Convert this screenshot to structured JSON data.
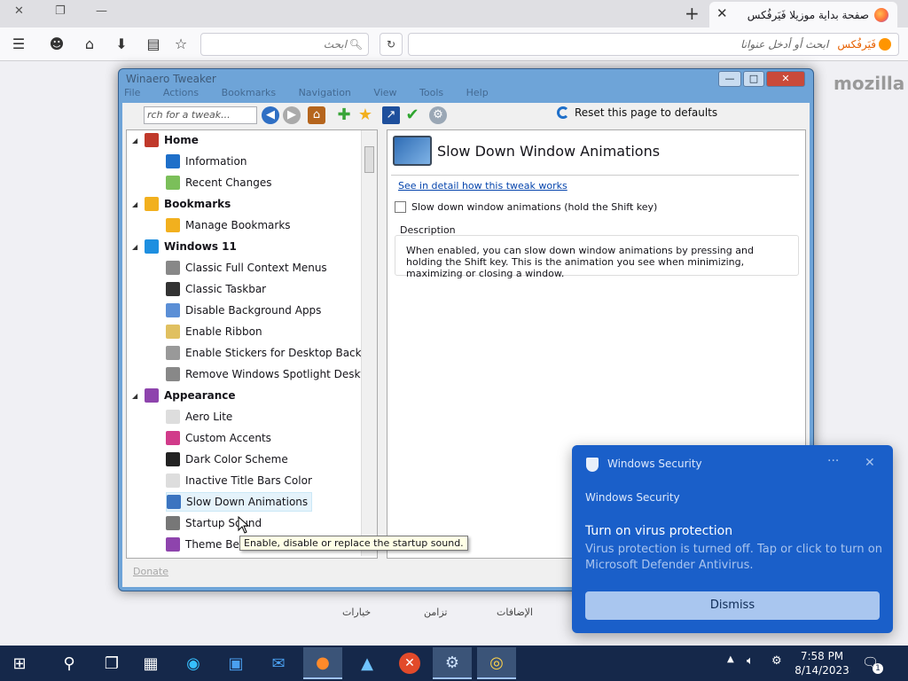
{
  "browser": {
    "tab_title": "صفحة بداية موزيلا فَيَرفُكس",
    "close_tab": "✕",
    "new_tab": "+",
    "win_controls": {
      "close": "✕",
      "restore": "❐",
      "minimize": "—"
    },
    "search_placeholder": "ابحث",
    "url_brand": "فَيَرفُكس",
    "url_placeholder": "ابحث أو أدخل عنوانا",
    "page_brand": "mozilla",
    "bottom_links": [
      "خيارات",
      "تزامن",
      "الإضافات"
    ]
  },
  "winaero": {
    "title": "Winaero Tweaker",
    "menu": [
      "File",
      "Actions",
      "Bookmarks",
      "Navigation",
      "View",
      "Tools",
      "Help"
    ],
    "search_placeholder": "rch for a tweak...",
    "reset_label": "Reset this page to defaults",
    "tree": [
      {
        "label": "Home",
        "type": "cat",
        "color": "#c0392b"
      },
      {
        "label": "Information",
        "type": "item",
        "color": "#1e6fc9"
      },
      {
        "label": "Recent Changes",
        "type": "item",
        "color": "#7bbf5a"
      },
      {
        "label": "Bookmarks",
        "type": "cat",
        "color": "#f2b01e"
      },
      {
        "label": "Manage Bookmarks",
        "type": "item",
        "color": "#f2b01e"
      },
      {
        "label": "Windows 11",
        "type": "cat",
        "color": "#1e8fe0"
      },
      {
        "label": "Classic Full Context Menus",
        "type": "item",
        "color": "#888888"
      },
      {
        "label": "Classic Taskbar",
        "type": "item",
        "color": "#333333"
      },
      {
        "label": "Disable Background Apps",
        "type": "item",
        "color": "#5b8fd6"
      },
      {
        "label": "Enable Ribbon",
        "type": "item",
        "color": "#e0c060"
      },
      {
        "label": "Enable Stickers for Desktop Background",
        "type": "item",
        "color": "#999999"
      },
      {
        "label": "Remove Windows Spotlight Desktop Icon",
        "type": "item",
        "color": "#888888"
      },
      {
        "label": "Appearance",
        "type": "cat",
        "color": "#8e44ad"
      },
      {
        "label": "Aero Lite",
        "type": "item",
        "color": "#dddddd"
      },
      {
        "label": "Custom Accents",
        "type": "item",
        "color": "#d13b8a"
      },
      {
        "label": "Dark Color Scheme",
        "type": "item",
        "color": "#222222"
      },
      {
        "label": "Inactive Title Bars Color",
        "type": "item",
        "color": "#dddddd"
      },
      {
        "label": "Slow Down Animations",
        "type": "item",
        "color": "#3b74c0",
        "selected": true
      },
      {
        "label": "Startup Sound",
        "type": "item",
        "color": "#777777"
      },
      {
        "label": "Theme Behavior",
        "type": "item",
        "color": "#8e44ad"
      }
    ],
    "tweak_title": "Slow Down Window Animations",
    "detail_link": "See in detail how this tweak works",
    "checkbox_label": "Slow down window animations (hold the Shift key)",
    "description_label": "Description",
    "description": "When enabled, you can slow down window animations by pressing and holding the Shift key. This is the animation you see when minimizing, maximizing or closing a window.",
    "status": "Donate",
    "tooltip": "Enable, disable or replace the startup sound."
  },
  "toast": {
    "app_name": "Windows Security",
    "header": "Windows Security",
    "title": "Turn on virus protection",
    "body": "Virus protection is turned off. Tap or click to turn on Microsoft Defender Antivirus.",
    "dismiss": "Dismiss",
    "accent": "#1a5fc9"
  },
  "taskbar": {
    "time": "7:58 PM",
    "date": "8/14/2023",
    "notifications": "1"
  }
}
